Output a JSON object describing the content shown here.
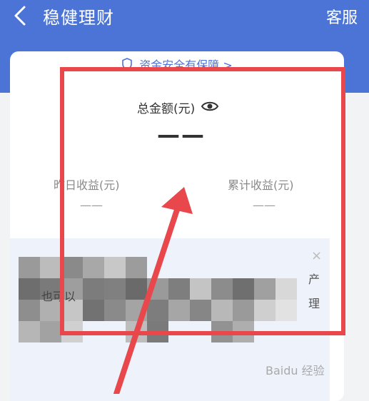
{
  "header": {
    "title": "稳健理财",
    "service": "客服"
  },
  "card": {
    "safety_text": "资金安全有保障 >",
    "total_label": "总金额(元)",
    "total_amount": "——",
    "yesterday_label": "昨日收益(元)",
    "yesterday_value": "——",
    "cumulative_label": "累计收益(元)",
    "cumulative_value": "——"
  },
  "promo": {
    "close": "×",
    "text_1": "产",
    "text_2": "理",
    "text_3": "也可以"
  },
  "watermark": "Baidu 经验",
  "colors": {
    "header_blue": "#4c74d6",
    "highlight_red": "#e8474c"
  }
}
